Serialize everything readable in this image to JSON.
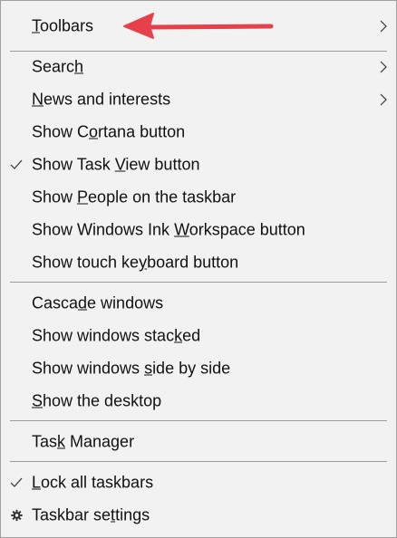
{
  "menu": {
    "items": [
      {
        "id": "toolbars",
        "pre": "",
        "ul": "T",
        "post": "oolbars",
        "submenu": true,
        "checked": false,
        "icon": ""
      },
      {
        "id": "search",
        "pre": "Searc",
        "ul": "h",
        "post": "",
        "submenu": true,
        "checked": false,
        "icon": ""
      },
      {
        "id": "news",
        "pre": "",
        "ul": "N",
        "post": "ews and interests",
        "submenu": true,
        "checked": false,
        "icon": ""
      },
      {
        "id": "cortana",
        "pre": "Show C",
        "ul": "o",
        "post": "rtana button",
        "submenu": false,
        "checked": false,
        "icon": ""
      },
      {
        "id": "taskview",
        "pre": "Show Task ",
        "ul": "V",
        "post": "iew button",
        "submenu": false,
        "checked": true,
        "icon": "check-icon"
      },
      {
        "id": "people",
        "pre": "Show ",
        "ul": "P",
        "post": "eople on the taskbar",
        "submenu": false,
        "checked": false,
        "icon": ""
      },
      {
        "id": "ink",
        "pre": "Show Windows Ink ",
        "ul": "W",
        "post": "orkspace button",
        "submenu": false,
        "checked": false,
        "icon": ""
      },
      {
        "id": "keyboard",
        "pre": "Show touch ke",
        "ul": "y",
        "post": "board button",
        "submenu": false,
        "checked": false,
        "icon": ""
      },
      {
        "id": "cascade",
        "pre": "Casca",
        "ul": "d",
        "post": "e windows",
        "submenu": false,
        "checked": false,
        "icon": ""
      },
      {
        "id": "stacked",
        "pre": "Show windows stac",
        "ul": "k",
        "post": "ed",
        "submenu": false,
        "checked": false,
        "icon": ""
      },
      {
        "id": "sidebyside",
        "pre": "Show windows ",
        "ul": "s",
        "post": "ide by side",
        "submenu": false,
        "checked": false,
        "icon": ""
      },
      {
        "id": "desktop",
        "pre": "",
        "ul": "S",
        "post": "how the desktop",
        "submenu": false,
        "checked": false,
        "icon": ""
      },
      {
        "id": "taskmanager",
        "pre": "Tas",
        "ul": "k",
        "post": " Manager",
        "submenu": false,
        "checked": false,
        "icon": ""
      },
      {
        "id": "lock",
        "pre": "",
        "ul": "L",
        "post": "ock all taskbars",
        "submenu": false,
        "checked": true,
        "icon": "check-icon"
      },
      {
        "id": "settings",
        "pre": "Taskbar se",
        "ul": "t",
        "post": "tings",
        "submenu": false,
        "checked": false,
        "icon": "gear-icon"
      }
    ]
  },
  "annotation": {
    "arrow_color": "#e8404a",
    "icon": "red-arrow-icon"
  },
  "colors": {
    "menu_bg": "#f2f2f2",
    "text": "#111111",
    "separator": "#9c9c9c"
  }
}
